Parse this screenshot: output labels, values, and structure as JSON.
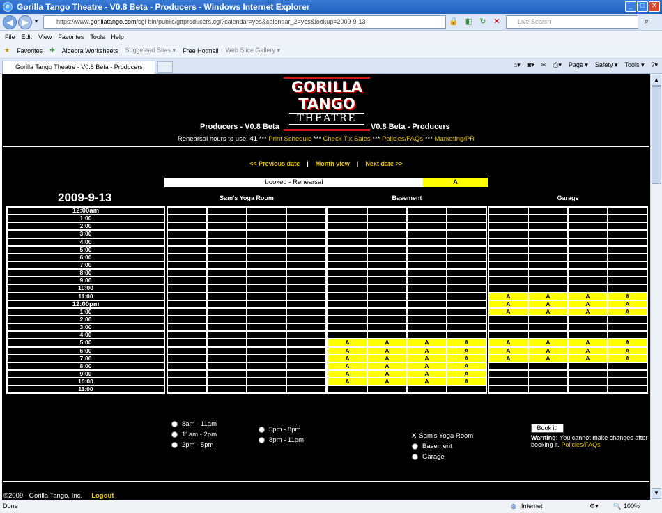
{
  "window": {
    "title": "Gorilla Tango Theatre - V0.8 Beta - Producers - Windows Internet Explorer"
  },
  "address": {
    "url_prefix": "https://www.",
    "url_domain": "gorillatango.com",
    "url_rest": "/cgi-bin/public/gttproducers.cgi?calendar=yes&calendar_2=yes&lookup=2009-9-13",
    "search_placeholder": "Live Search"
  },
  "menu": [
    "File",
    "Edit",
    "View",
    "Favorites",
    "Tools",
    "Help"
  ],
  "favorites": {
    "label": "Favorites",
    "items": [
      "Algebra Worksheets",
      "Suggested Sites ▾",
      "Free Hotmail",
      "Web Slice Gallery ▾"
    ]
  },
  "tab": {
    "label": "Gorilla Tango Theatre - V0.8 Beta - Producers"
  },
  "commandbar": [
    "Page ▾",
    "Safety ▾",
    "Tools ▾"
  ],
  "logo": {
    "line1": "GORILLA",
    "line2": "TANGO",
    "line3": "THEATRE"
  },
  "header": {
    "left": "Producers - V0.8 Beta",
    "right": "V0.8 Beta - Producers"
  },
  "info": {
    "prefix": "Rehearsal hours to use:",
    "hours": "41",
    "sep": "***",
    "links": [
      "Print Schedule",
      "Check Tix Sales",
      "Policies/FAQs",
      "Marketing/PR"
    ]
  },
  "datenav": {
    "prev": "<< Previous date",
    "month": "Month view",
    "next": "Next date >>",
    "sep": "|"
  },
  "legend": {
    "text": "booked - Rehearsal",
    "code": "A"
  },
  "date": "2009-9-13",
  "rooms": [
    "Sam's Yoga Room",
    "Basement",
    "Garage"
  ],
  "times": [
    "12:00am",
    "1:00",
    "2:00",
    "3:00",
    "4:00",
    "5:00",
    "6:00",
    "7:00",
    "8:00",
    "9:00",
    "10:00",
    "11:00",
    "12:00pm",
    "1:00",
    "2:00",
    "3:00",
    "4:00",
    "5:00",
    "6:00",
    "7:00",
    "8:00",
    "9:00",
    "10:00",
    "11:00"
  ],
  "bold_times": [
    0,
    12
  ],
  "schedule": {
    "sams_yoga_room": [],
    "basement": [
      17,
      18,
      19,
      20,
      21,
      22
    ],
    "garage": [
      11,
      12,
      13,
      17,
      18,
      19
    ]
  },
  "booking_code": "A",
  "time_options_col1": [
    "8am - 11am",
    "11am - 2pm",
    "2pm - 5pm"
  ],
  "time_options_col2": [
    "5pm - 8pm",
    "8pm - 11pm"
  ],
  "room_options": {
    "selected_mark": "X",
    "selected": "Sam's Yoga Room",
    "others": [
      "Basement",
      "Garage"
    ]
  },
  "book_button": "Book it!",
  "warning": {
    "label": "Warning:",
    "text": "You cannot make changes after booking it.",
    "link": "Policies/FAQs"
  },
  "footer": {
    "copyright": "©2009 - Gorilla Tango, Inc.",
    "logout": "Logout"
  },
  "statusbar": {
    "left": "Done",
    "zone": "Internet",
    "zoom": "100%"
  }
}
